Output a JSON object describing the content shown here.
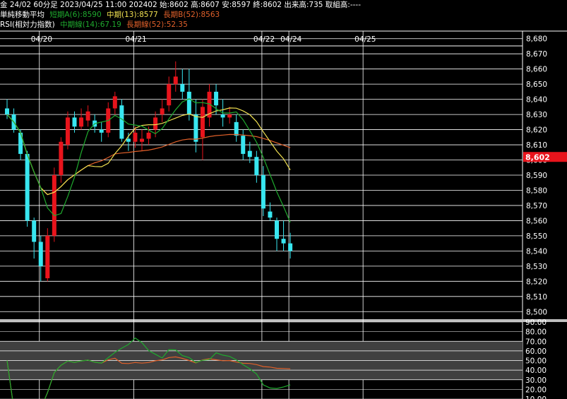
{
  "header": {
    "quote_line": "金 24/02 60分足 2023/04/25 11:00 202402 始:8602 高:8607 安:8597 終:8602 出来高:735 取組高:----",
    "ma_title": "単純移動平均",
    "ma_short": "短期A(6):8590",
    "ma_mid": "中期(13):8577",
    "ma_long": "長期B(52):8563",
    "rsi_title": "RSI(相対力指数)",
    "rsi_mid": "中期線(14):67.19",
    "rsi_long": "長期線(52):52.35"
  },
  "colors": {
    "background": "#000000",
    "grid": "#ffffff",
    "up_candle": "#e8141c",
    "down_candle": "#38e6f0",
    "ma_short": "#1faa2e",
    "ma_mid": "#f0e050",
    "ma_long": "#e0602a",
    "rsi_mid": "#1faa2e",
    "rsi_long": "#e0602a",
    "price_tag": "#e8141c"
  },
  "chart_data": [
    {
      "type": "candlestick",
      "date_labels": [
        {
          "label": "04/20",
          "index": 5
        },
        {
          "label": "04/21",
          "index": 19
        },
        {
          "label": "04/22",
          "index": 38
        },
        {
          "label": "04/24",
          "index": 42
        },
        {
          "label": "04/25",
          "index": 53
        }
      ],
      "ylim": [
        8495,
        8685
      ],
      "yticks": [
        "8,500",
        "8,510",
        "8,520",
        "8,530",
        "8,540",
        "8,550",
        "8,560",
        "8,570",
        "8,580",
        "8,590",
        "8,600",
        "8,610",
        "8,620",
        "8,630",
        "8,640",
        "8,650",
        "8,660",
        "8,670",
        "8,680"
      ],
      "last_price_label": "8,602",
      "last_price": 8602,
      "candles": [
        [
          8634,
          8640,
          8627,
          8630
        ],
        [
          8630,
          8634,
          8618,
          8620
        ],
        [
          8618,
          8620,
          8600,
          8604
        ],
        [
          8604,
          8606,
          8556,
          8560
        ],
        [
          8560,
          8562,
          8535,
          8546
        ],
        [
          8546,
          8550,
          8520,
          8530
        ],
        [
          8522,
          8555,
          8520,
          8550
        ],
        [
          8550,
          8595,
          8546,
          8590
        ],
        [
          8590,
          8615,
          8585,
          8612
        ],
        [
          8610,
          8632,
          8607,
          8628
        ],
        [
          8628,
          8632,
          8618,
          8622
        ],
        [
          8622,
          8634,
          8620,
          8628
        ],
        [
          8626,
          8636,
          8622,
          8632
        ],
        [
          8626,
          8630,
          8618,
          8622
        ],
        [
          8620,
          8625,
          8612,
          8618
        ],
        [
          8618,
          8638,
          8615,
          8634
        ],
        [
          8634,
          8645,
          8630,
          8642
        ],
        [
          8636,
          8640,
          8612,
          8614
        ],
        [
          8614,
          8618,
          8606,
          8612
        ],
        [
          8612,
          8622,
          8608,
          8618
        ],
        [
          8612,
          8620,
          8606,
          8614
        ],
        [
          8614,
          8622,
          8610,
          8618
        ],
        [
          8620,
          8632,
          8615,
          8628
        ],
        [
          8630,
          8640,
          8625,
          8634
        ],
        [
          8636,
          8655,
          8632,
          8650
        ],
        [
          8650,
          8665,
          8645,
          8655
        ],
        [
          8650,
          8660,
          8640,
          8645
        ],
        [
          8645,
          8660,
          8626,
          8630
        ],
        [
          8630,
          8640,
          8605,
          8612
        ],
        [
          8615,
          8640,
          8600,
          8635
        ],
        [
          8628,
          8650,
          8622,
          8645
        ],
        [
          8645,
          8650,
          8630,
          8636
        ],
        [
          8630,
          8640,
          8622,
          8628
        ],
        [
          8628,
          8635,
          8624,
          8630
        ],
        [
          8625,
          8630,
          8612,
          8616
        ],
        [
          8616,
          8620,
          8600,
          8604
        ],
        [
          8606,
          8612,
          8598,
          8602
        ],
        [
          8602,
          8606,
          8585,
          8590
        ],
        [
          8590,
          8596,
          8563,
          8568
        ],
        [
          8566,
          8572,
          8560,
          8562
        ],
        [
          8560,
          8562,
          8540,
          8548
        ],
        [
          8548,
          8560,
          8540,
          8545
        ],
        [
          8545,
          8552,
          8535,
          8540
        ]
      ],
      "rsi_ylim": [
        10,
        90
      ],
      "rsi_yticks": [
        "10.00",
        "20.00",
        "30.00",
        "40.00",
        "50.00",
        "60.00",
        "70.00",
        "80.00",
        "90.00"
      ],
      "rsi_band_labels": [
        "70.00",
        "60.00",
        "50.00",
        "40.00",
        "30.00"
      ]
    }
  ]
}
